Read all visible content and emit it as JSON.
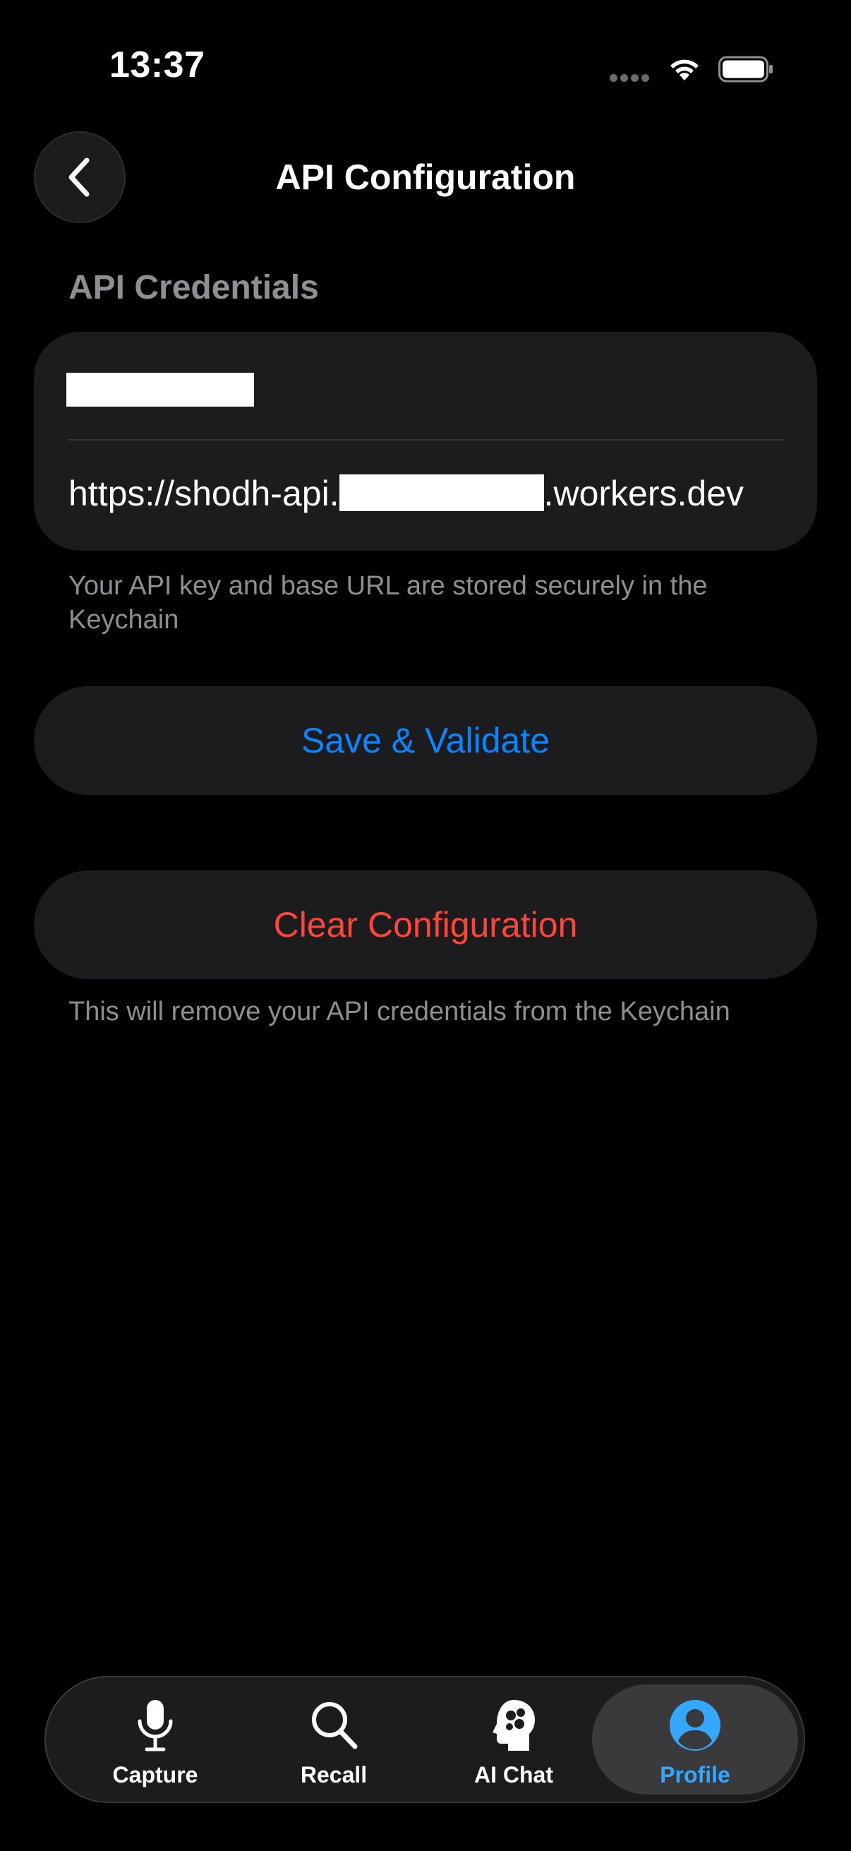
{
  "status_bar": {
    "time": "13:37"
  },
  "header": {
    "title": "API Configuration",
    "back_icon": "chevron-left-icon"
  },
  "section": {
    "title": "API Credentials"
  },
  "credentials": {
    "url_prefix": "https://shodh-api.",
    "url_suffix": ".workers.dev"
  },
  "helper_stored": "Your API key and base URL are stored securely in the Keychain",
  "buttons": {
    "save": "Save & Validate",
    "clear": "Clear Configuration"
  },
  "helper_clear": "This will remove your API credentials from the Keychain",
  "colors": {
    "accent": "#0a84ff",
    "destructive": "#ff453a",
    "tab_active": "#35a7ff"
  },
  "tabs": [
    {
      "label": "Capture",
      "icon": "microphone-icon"
    },
    {
      "label": "Recall",
      "icon": "search-icon"
    },
    {
      "label": "AI Chat",
      "icon": "brain-head-icon"
    },
    {
      "label": "Profile",
      "icon": "person-circle-icon",
      "active": true
    }
  ]
}
